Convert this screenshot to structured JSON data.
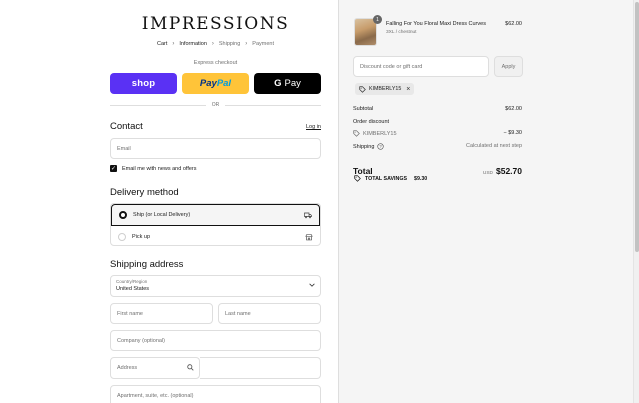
{
  "brand": "IMPRESSIONS",
  "breadcrumb": [
    "Cart",
    "Information",
    "Shipping",
    "Payment"
  ],
  "express": {
    "label": "Express checkout",
    "shop_label": "shop",
    "paypal_pay": "Pay",
    "paypal_pal": "Pal",
    "gpay_g": "G",
    "gpay_pay": "Pay"
  },
  "or_label": "OR",
  "contact": {
    "title": "Contact",
    "login": "Log in",
    "email_placeholder": "Email",
    "newsletter_label": "Email me with news and offers",
    "newsletter_checked": true
  },
  "delivery": {
    "title": "Delivery method",
    "options": [
      {
        "label": "Ship (or Local Delivery)",
        "selected": true,
        "icon": "truck-icon"
      },
      {
        "label": "Pick up",
        "selected": false,
        "icon": "store-icon"
      }
    ]
  },
  "shipping": {
    "title": "Shipping address",
    "country_label": "Country/Region",
    "country_value": "United States",
    "first_name": "First name",
    "last_name": "Last name",
    "company": "Company (optional)",
    "address": "Address",
    "apartment": "Apartment, suite, etc. (optional)"
  },
  "order": {
    "product_name": "Falling For You Floral Maxi Dress Curves",
    "variant": "3XL / chestnut",
    "price": "$62.00",
    "quantity": "1",
    "discount_placeholder": "Discount code or gift card",
    "apply_label": "Apply",
    "applied_code": "KIMBERLY15",
    "subtotal_label": "Subtotal",
    "subtotal_value": "$62.00",
    "order_discount_label": "Order discount",
    "discount_code": "KIMBERLY15",
    "discount_value": "− $9.30",
    "shipping_label": "Shipping",
    "shipping_value": "Calculated at next step",
    "total_label": "Total",
    "currency": "USD",
    "total_value": "$52.70",
    "savings_label": "TOTAL SAVINGS",
    "savings_value": "$9.30"
  },
  "colors": {
    "shop": "#5a31f4",
    "paypal": "#ffc439",
    "gpay": "#000000",
    "summary_bg": "#f5f5f5"
  }
}
